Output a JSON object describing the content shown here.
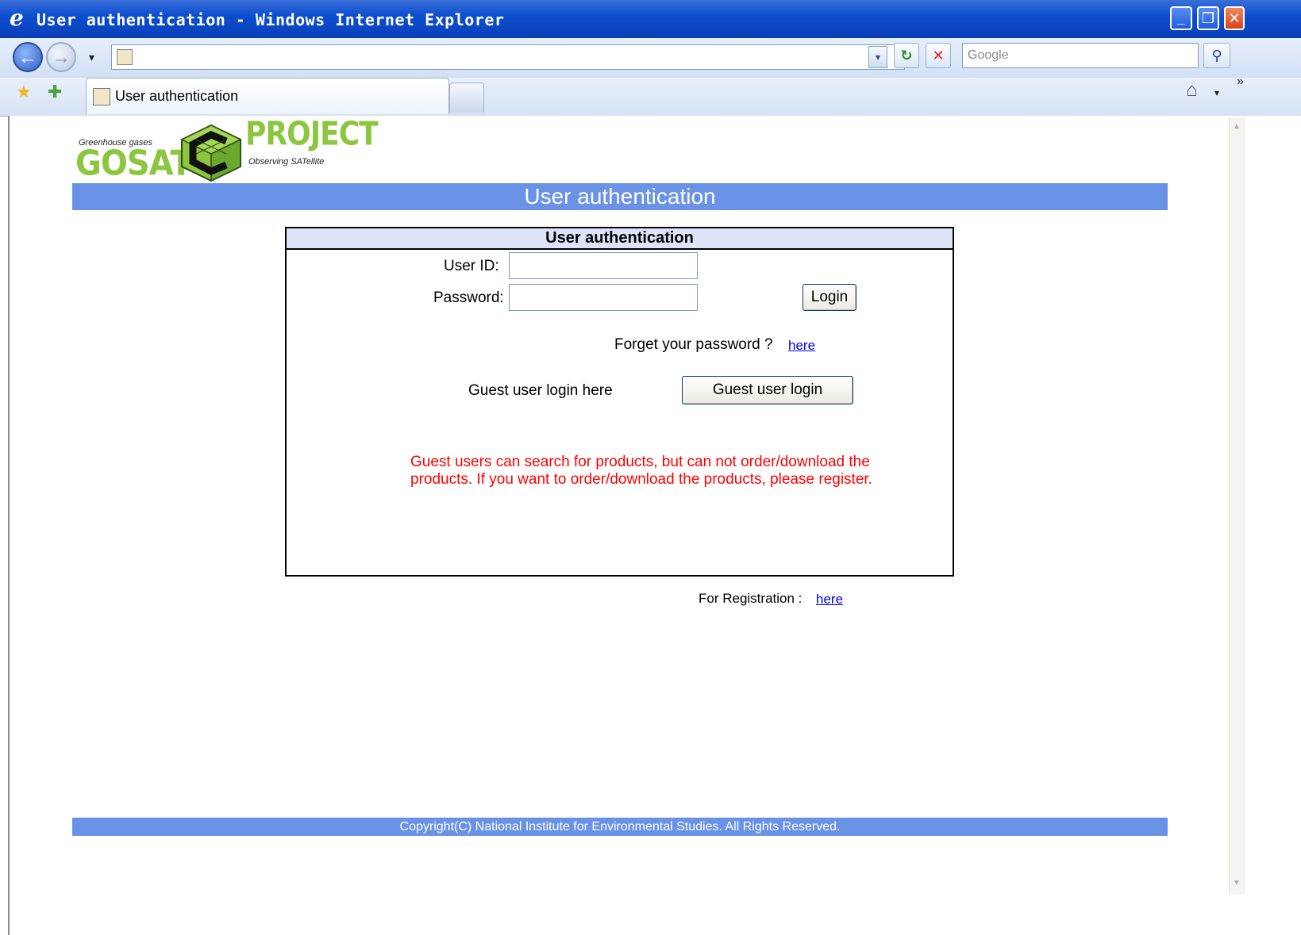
{
  "window": {
    "title": "User authentication - Windows Internet Explorer",
    "minimize": "_",
    "restore": "❐",
    "close": "✕"
  },
  "toolbar": {
    "back": "←",
    "forward": "→",
    "history_dropdown": "▾",
    "address_value": "",
    "address_dropdown": "▾",
    "refresh": "↻",
    "stop": "✕",
    "search_placeholder": "Google",
    "search_icon": "⚲"
  },
  "tabs": {
    "favorites_star": "★",
    "add_favorite": "✚",
    "active_tab_label": "User authentication",
    "home": "⌂",
    "home_dropdown": "▾",
    "overflow": "»"
  },
  "page": {
    "logo": {
      "greenhouse": "Greenhouse gases",
      "gosat": "GOSAT",
      "project": "PROJECT",
      "observing": "Observing SATellite"
    },
    "header_title": "User authentication",
    "box_title": "User authentication",
    "user_id_label": "User ID:",
    "password_label": "Password:",
    "login_button": "Login",
    "forgot_text": "Forget your password ?",
    "forgot_link": "here",
    "guest_text": "Guest user login here",
    "guest_button": "Guest user login",
    "guest_notice": "Guest users can search for products, but can not order/download the products. If you want to order/download the products, please register.",
    "registration_text": "For Registration :",
    "registration_link": "here",
    "footer": "Copyright(C) National Institute for Environmental Studies. All Rights Reserved."
  },
  "colors": {
    "title_bar": "#0d4fd0",
    "band": "#6a93e8",
    "box_header": "#dde4fa",
    "notice": "#ff0000",
    "logo_green": "#8cc63f",
    "link": "#0000ee"
  }
}
